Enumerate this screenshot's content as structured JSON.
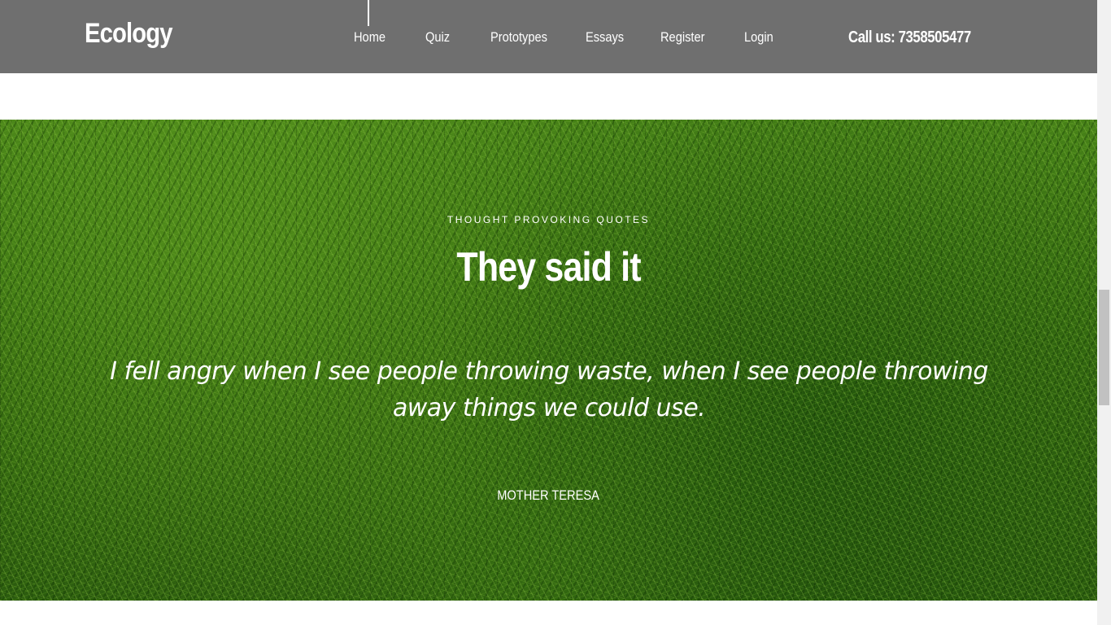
{
  "header": {
    "brand": "Ecology",
    "nav": [
      "Home",
      "Quiz",
      "Prototypes",
      "Essays",
      "Register",
      "Login"
    ],
    "phone": "Call us: 7358505477"
  },
  "quote_section": {
    "eyebrow": "THOUGHT PROVOKING QUOTES",
    "title": "They said it",
    "quote": "I fell angry when I see people throwing waste, when I see people throwing away things we could use.",
    "author": "MOTHER TERESA"
  }
}
